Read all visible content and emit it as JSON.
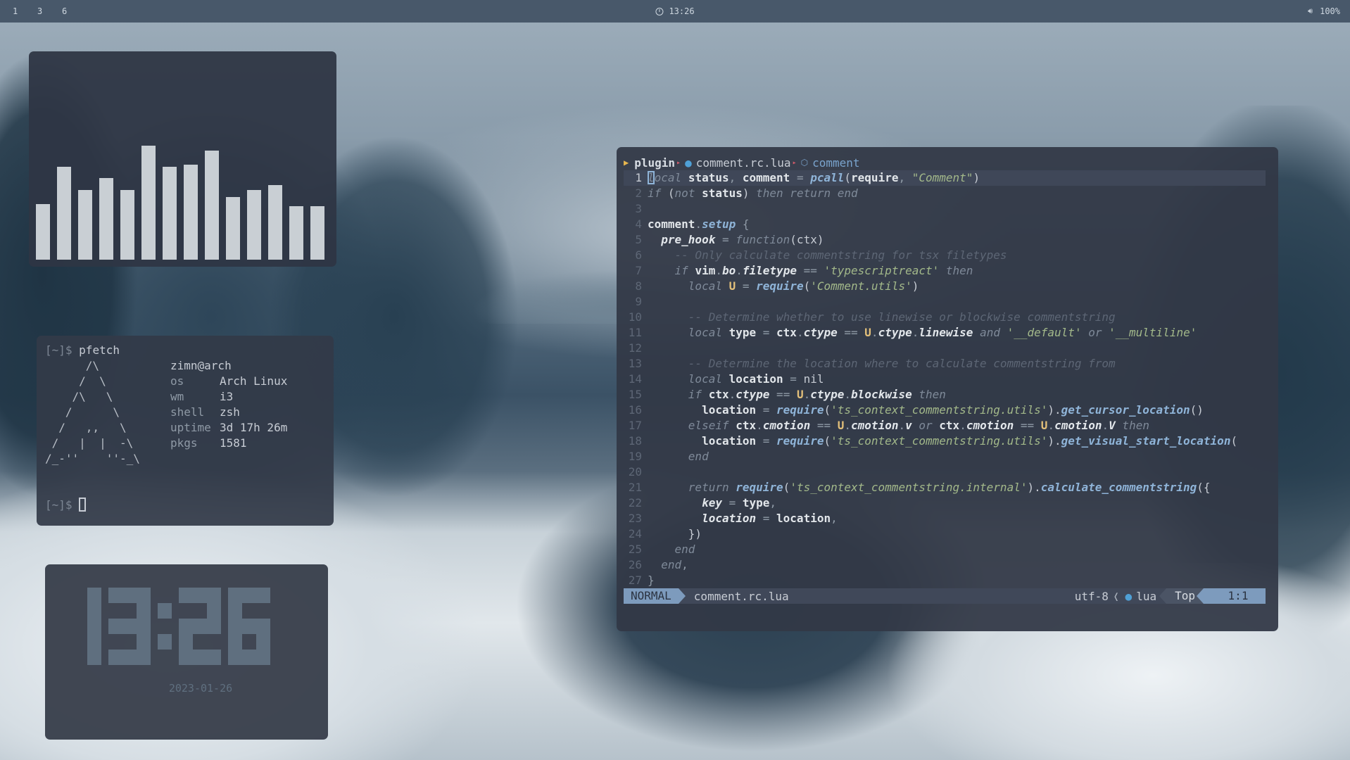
{
  "topbar": {
    "workspaces": [
      "1",
      "3",
      "6"
    ],
    "clock": "13:26",
    "clock_icon": "clock-icon",
    "volume_icon": "volume-icon",
    "volume": "100%"
  },
  "visualizer": {
    "bar_levels": [
      0.24,
      0.4,
      0.3,
      0.35,
      0.3,
      0.49,
      0.4,
      0.41,
      0.47,
      0.27,
      0.3,
      0.32,
      0.23,
      0.23
    ],
    "bar_levels_note": "relative heights, 0-1 of panel height",
    "bar_color": "#c9cfd4"
  },
  "terminal": {
    "prompt": "[~]$",
    "command": "pfetch",
    "ascii_art": [
      "      /\\",
      "     /  \\",
      "    /\\   \\",
      "   /      \\",
      "  /   ,,   \\",
      " /   |  |  -\\",
      "/_-''    ''-_\\"
    ],
    "user_host": "zimn@arch",
    "info": [
      {
        "key": "os",
        "value": "Arch Linux"
      },
      {
        "key": "wm",
        "value": "i3"
      },
      {
        "key": "shell",
        "value": "zsh"
      },
      {
        "key": "uptime",
        "value": "3d 17h 26m"
      },
      {
        "key": "pkgs",
        "value": "1581"
      }
    ],
    "second_prompt": "[~]$"
  },
  "clock_widget": {
    "time": "13:26",
    "date": "2023-01-26",
    "color": "#5f6f7f"
  },
  "editor": {
    "winbar": {
      "folder": "plugin",
      "file": "comment.rc.lua",
      "symbol": "comment"
    },
    "lines": [
      {
        "n": "1",
        "current": true,
        "segs": [
          [
            "kw cursorcell",
            "l"
          ],
          [
            "kw",
            "ocal "
          ],
          [
            "id",
            "status"
          ],
          [
            "op",
            ", "
          ],
          [
            "id",
            "comment"
          ],
          [
            "op",
            " = "
          ],
          [
            "fn",
            "pcall"
          ],
          [
            "tx",
            "("
          ],
          [
            "id",
            "require"
          ],
          [
            "op",
            ", "
          ],
          [
            "str",
            "\"Comment\""
          ],
          [
            "tx",
            ")"
          ]
        ]
      },
      {
        "n": "2",
        "segs": [
          [
            "kw",
            "if "
          ],
          [
            "tx",
            "("
          ],
          [
            "kw",
            "not "
          ],
          [
            "id",
            "status"
          ],
          [
            "tx",
            ") "
          ],
          [
            "kw",
            "then return end"
          ]
        ]
      },
      {
        "n": "3",
        "segs": []
      },
      {
        "n": "4",
        "segs": [
          [
            "id",
            "comment"
          ],
          [
            "op",
            "."
          ],
          [
            "fn",
            "setup"
          ],
          [
            "op",
            " {"
          ]
        ]
      },
      {
        "n": "5",
        "segs": [
          [
            "tx",
            "  "
          ],
          [
            "prop",
            "pre_hook"
          ],
          [
            "op",
            " = "
          ],
          [
            "kw",
            "function"
          ],
          [
            "tx",
            "(ctx)"
          ]
        ]
      },
      {
        "n": "6",
        "segs": [
          [
            "tx",
            "    "
          ],
          [
            "cm",
            "-- Only calculate commentstring for tsx filetypes"
          ]
        ]
      },
      {
        "n": "7",
        "segs": [
          [
            "tx",
            "    "
          ],
          [
            "kw",
            "if "
          ],
          [
            "id",
            "vim"
          ],
          [
            "op",
            "."
          ],
          [
            "prop",
            "bo"
          ],
          [
            "op",
            "."
          ],
          [
            "prop",
            "filetype"
          ],
          [
            "op",
            " == "
          ],
          [
            "str",
            "'typescriptreact'"
          ],
          [
            "kw",
            " then"
          ]
        ]
      },
      {
        "n": "8",
        "segs": [
          [
            "tx",
            "      "
          ],
          [
            "kw",
            "local "
          ],
          [
            "ty",
            "U"
          ],
          [
            "op",
            " = "
          ],
          [
            "fn",
            "require"
          ],
          [
            "tx",
            "("
          ],
          [
            "str",
            "'Comment.utils'"
          ],
          [
            "tx",
            ")"
          ]
        ]
      },
      {
        "n": "9",
        "segs": []
      },
      {
        "n": "10",
        "segs": [
          [
            "tx",
            "      "
          ],
          [
            "cm",
            "-- Determine whether to use linewise or blockwise commentstring"
          ]
        ]
      },
      {
        "n": "11",
        "segs": [
          [
            "tx",
            "      "
          ],
          [
            "kw",
            "local "
          ],
          [
            "id",
            "type"
          ],
          [
            "op",
            " = "
          ],
          [
            "id",
            "ctx"
          ],
          [
            "op",
            "."
          ],
          [
            "prop",
            "ctype"
          ],
          [
            "op",
            " == "
          ],
          [
            "ty",
            "U"
          ],
          [
            "op",
            "."
          ],
          [
            "prop",
            "ctype"
          ],
          [
            "op",
            "."
          ],
          [
            "prop",
            "linewise"
          ],
          [
            "kw",
            " and "
          ],
          [
            "str",
            "'__default'"
          ],
          [
            "kw",
            " or "
          ],
          [
            "str",
            "'__multiline'"
          ]
        ]
      },
      {
        "n": "12",
        "segs": []
      },
      {
        "n": "13",
        "segs": [
          [
            "tx",
            "      "
          ],
          [
            "cm",
            "-- Determine the location where to calculate commentstring from"
          ]
        ]
      },
      {
        "n": "14",
        "segs": [
          [
            "tx",
            "      "
          ],
          [
            "kw",
            "local "
          ],
          [
            "id",
            "location"
          ],
          [
            "op",
            " = "
          ],
          [
            "num",
            "nil"
          ]
        ]
      },
      {
        "n": "15",
        "segs": [
          [
            "tx",
            "      "
          ],
          [
            "kw",
            "if "
          ],
          [
            "id",
            "ctx"
          ],
          [
            "op",
            "."
          ],
          [
            "prop",
            "ctype"
          ],
          [
            "op",
            " == "
          ],
          [
            "ty",
            "U"
          ],
          [
            "op",
            "."
          ],
          [
            "prop",
            "ctype"
          ],
          [
            "op",
            "."
          ],
          [
            "prop",
            "blockwise"
          ],
          [
            "kw",
            " then"
          ]
        ]
      },
      {
        "n": "16",
        "segs": [
          [
            "tx",
            "        "
          ],
          [
            "id",
            "location"
          ],
          [
            "op",
            " = "
          ],
          [
            "fn",
            "require"
          ],
          [
            "tx",
            "("
          ],
          [
            "str",
            "'ts_context_commentstring.utils'"
          ],
          [
            "tx",
            ")."
          ],
          [
            "fn",
            "get_cursor_location"
          ],
          [
            "tx",
            "()"
          ]
        ]
      },
      {
        "n": "17",
        "segs": [
          [
            "tx",
            "      "
          ],
          [
            "kw",
            "elseif "
          ],
          [
            "id",
            "ctx"
          ],
          [
            "op",
            "."
          ],
          [
            "prop",
            "cmotion"
          ],
          [
            "op",
            " == "
          ],
          [
            "ty",
            "U"
          ],
          [
            "op",
            "."
          ],
          [
            "prop",
            "cmotion"
          ],
          [
            "op",
            "."
          ],
          [
            "prop",
            "v"
          ],
          [
            "kw",
            " or "
          ],
          [
            "id",
            "ctx"
          ],
          [
            "op",
            "."
          ],
          [
            "prop",
            "cmotion"
          ],
          [
            "op",
            " == "
          ],
          [
            "ty",
            "U"
          ],
          [
            "op",
            "."
          ],
          [
            "prop",
            "cmotion"
          ],
          [
            "op",
            "."
          ],
          [
            "prop",
            "V"
          ],
          [
            "kw",
            " then"
          ]
        ]
      },
      {
        "n": "18",
        "segs": [
          [
            "tx",
            "        "
          ],
          [
            "id",
            "location"
          ],
          [
            "op",
            " = "
          ],
          [
            "fn",
            "require"
          ],
          [
            "tx",
            "("
          ],
          [
            "str",
            "'ts_context_commentstring.utils'"
          ],
          [
            "tx",
            ")."
          ],
          [
            "fn",
            "get_visual_start_location"
          ],
          [
            "tx",
            "("
          ]
        ]
      },
      {
        "n": "19",
        "segs": [
          [
            "tx",
            "      "
          ],
          [
            "kw",
            "end"
          ]
        ]
      },
      {
        "n": "20",
        "segs": []
      },
      {
        "n": "21",
        "segs": [
          [
            "tx",
            "      "
          ],
          [
            "kw",
            "return "
          ],
          [
            "fn",
            "require"
          ],
          [
            "tx",
            "("
          ],
          [
            "str",
            "'ts_context_commentstring.internal'"
          ],
          [
            "tx",
            ")."
          ],
          [
            "fn",
            "calculate_commentstring"
          ],
          [
            "tx",
            "({"
          ]
        ]
      },
      {
        "n": "22",
        "segs": [
          [
            "tx",
            "        "
          ],
          [
            "prop",
            "key"
          ],
          [
            "op",
            " = "
          ],
          [
            "id",
            "type"
          ],
          [
            "op",
            ","
          ]
        ]
      },
      {
        "n": "23",
        "segs": [
          [
            "tx",
            "        "
          ],
          [
            "prop",
            "location"
          ],
          [
            "op",
            " = "
          ],
          [
            "id",
            "location"
          ],
          [
            "op",
            ","
          ]
        ]
      },
      {
        "n": "24",
        "segs": [
          [
            "tx",
            "      })"
          ]
        ]
      },
      {
        "n": "25",
        "segs": [
          [
            "tx",
            "    "
          ],
          [
            "kw",
            "end"
          ]
        ]
      },
      {
        "n": "26",
        "segs": [
          [
            "tx",
            "  "
          ],
          [
            "kw",
            "end"
          ],
          [
            "op",
            ","
          ]
        ]
      },
      {
        "n": "27",
        "segs": [
          [
            "op",
            "}"
          ]
        ]
      }
    ],
    "statusline": {
      "mode": "NORMAL",
      "file": "comment.rc.lua",
      "encoding": "utf-8",
      "filetype": "lua",
      "scroll": "Top",
      "position": "1:1"
    }
  }
}
